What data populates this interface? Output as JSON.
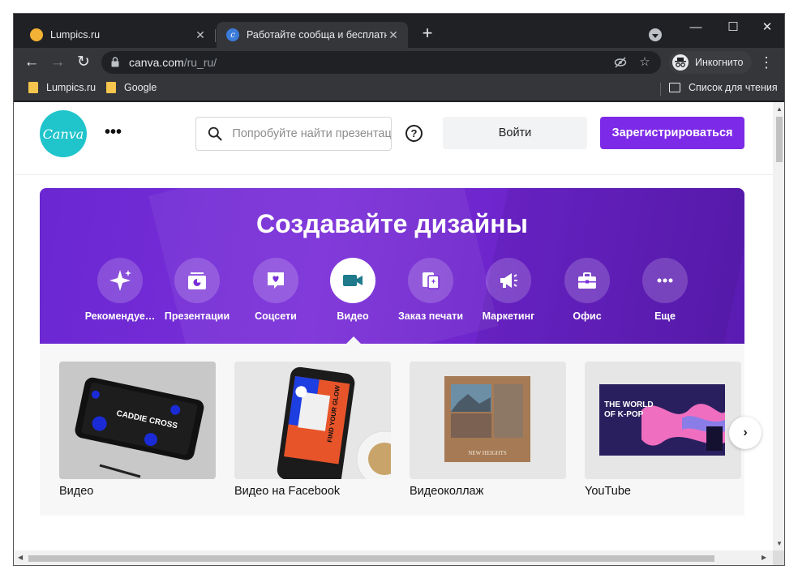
{
  "browser": {
    "tabs": [
      {
        "title": "Lumpics.ru",
        "favicon_color": "#f2b233",
        "active": false
      },
      {
        "title": "Работайте сообща и бесплатно",
        "favicon_color": "#3b7bd9",
        "active": true
      }
    ],
    "close_glyph": "✕",
    "new_tab_glyph": "+",
    "window_controls": {
      "minimize": "—",
      "maximize": "☐",
      "close": "✕"
    },
    "url_host": "canva.com",
    "url_path": "/ru_ru/",
    "incognito_label": "Инкогнито",
    "bookmarks": [
      {
        "label": "Lumpics.ru",
        "icon": "folder-icon"
      },
      {
        "label": "Google",
        "icon": "folder-icon"
      }
    ],
    "reading_list_label": "Список для чтения"
  },
  "canva": {
    "logo_text": "Canva",
    "more_glyph": "•••",
    "search_placeholder": "Попробуйте найти презентации",
    "help_glyph": "?",
    "login_label": "Войти",
    "signup_label": "Зарегистрироваться",
    "hero_title": "Создавайте дизайны",
    "categories": [
      {
        "label": "Рекомендуе…",
        "icon": "sparkle-icon"
      },
      {
        "label": "Презентации",
        "icon": "presentation-icon"
      },
      {
        "label": "Соцсети",
        "icon": "heart-chat-icon"
      },
      {
        "label": "Видео",
        "icon": "video-camera-icon",
        "active": true
      },
      {
        "label": "Заказ печати",
        "icon": "print-order-icon"
      },
      {
        "label": "Маркетинг",
        "icon": "megaphone-icon"
      },
      {
        "label": "Офис",
        "icon": "briefcase-icon"
      },
      {
        "label": "Еще",
        "icon": "more-icon"
      }
    ],
    "cards": [
      {
        "label": "Видео",
        "thumb_text": "CADDIE CROSS"
      },
      {
        "label": "Видео на Facebook",
        "thumb_text": "FIND YOUR GLOW"
      },
      {
        "label": "Видеоколлаж",
        "thumb_text": "NEW HEIGHTS"
      },
      {
        "label": "YouTube",
        "thumb_text": "THE WORLD OF K-POP"
      }
    ],
    "next_glyph": "›"
  },
  "colors": {
    "accent": "#7d2ae8",
    "logo": "#20c4cb",
    "hero": "#6a27d2"
  }
}
